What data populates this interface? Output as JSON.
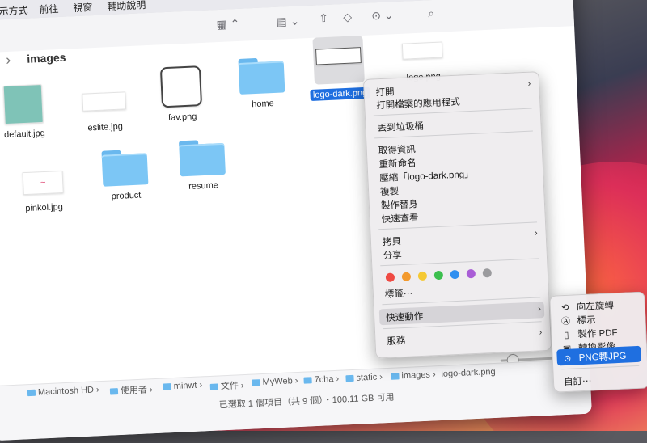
{
  "menubar": {
    "items": [
      "顯示方式",
      "前往",
      "視窗",
      "輔助說明"
    ]
  },
  "toolbar": {
    "icons": [
      "grid-view-icon",
      "group-icon",
      "share-icon",
      "tag-icon",
      "more-icon",
      "search-icon"
    ]
  },
  "folder_title": "images",
  "files": [
    {
      "name": "default.jpg",
      "kind": "thumb-teal"
    },
    {
      "name": "eslite.jpg",
      "kind": "thumb-text"
    },
    {
      "name": "fav.png",
      "kind": "thumb-pixel"
    },
    {
      "name": "home",
      "kind": "folder"
    },
    {
      "name": "logo-dark.png",
      "kind": "thumb-selected"
    },
    {
      "name": "logo.png",
      "kind": "thumb-plain"
    },
    {
      "name": "pinkoi.jpg",
      "kind": "thumb-pink"
    },
    {
      "name": "product",
      "kind": "folder"
    },
    {
      "name": "resume",
      "kind": "folder"
    }
  ],
  "context_menu": {
    "open": "打開",
    "open_with": "打開檔案的應用程式",
    "trash": "丟到垃圾桶",
    "get_info": "取得資訊",
    "rename": "重新命名",
    "compress": "壓縮「logo-dark.png」",
    "duplicate": "複製",
    "make_alias": "製作替身",
    "quick_look": "快速查看",
    "copy": "拷貝",
    "share": "分享",
    "tag_colors": [
      "#ef4a43",
      "#f39a2e",
      "#f5c933",
      "#3cbf4e",
      "#2f8ff0",
      "#a95dd6",
      "#9b9b9e"
    ],
    "tags": "標籤⋯",
    "quick_actions": "快速動作",
    "services": "服務"
  },
  "submenu": {
    "rotate_left": "向左旋轉",
    "markup": "標示",
    "create_pdf": "製作 PDF",
    "convert_image": "轉換影像",
    "png_to_jpg": "PNG轉JPG",
    "customize": "自訂⋯"
  },
  "pathbar": {
    "crumbs": [
      "Macintosh HD",
      "使用者",
      "minwt",
      "文件",
      "MyWeb",
      "7cha",
      "static",
      "images",
      "logo-dark.png"
    ]
  },
  "status": "已選取 1 個項目（共 9 個）・100.11 GB 可用"
}
